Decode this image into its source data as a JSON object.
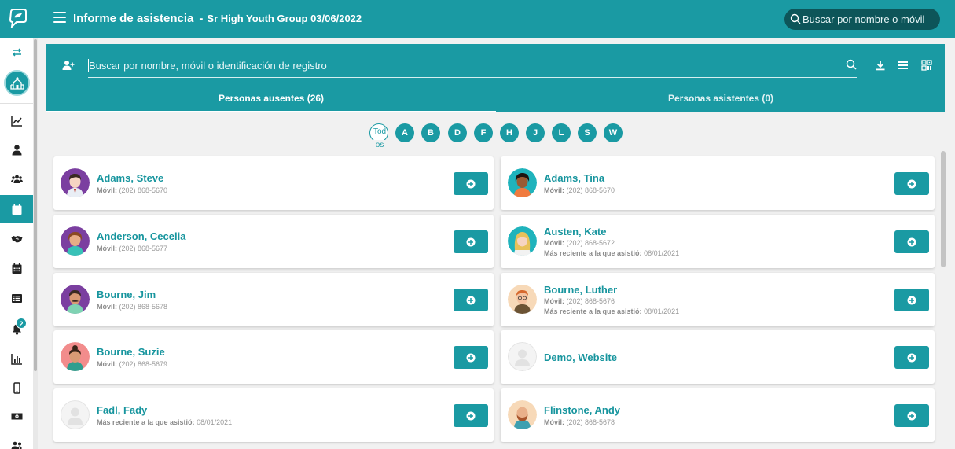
{
  "header": {
    "title": "Informe de asistencia",
    "separator": "-",
    "subtitle": "Sr High Youth Group 03/06/2022",
    "search_placeholder": "Buscar por nombre o móvil",
    "brand_color": "#1a9aa3"
  },
  "sidebar": {
    "items": [
      {
        "icon": "swap-icon"
      },
      {
        "icon": "church-icon"
      },
      {
        "icon": "trend-chart-icon"
      },
      {
        "icon": "person-icon"
      },
      {
        "icon": "group-icon"
      },
      {
        "icon": "calendar-icon",
        "active": true
      },
      {
        "icon": "handshake-icon"
      },
      {
        "icon": "calendar-grid-icon"
      },
      {
        "icon": "list-icon"
      },
      {
        "icon": "bell-icon"
      },
      {
        "icon": "bar-chart-icon"
      },
      {
        "icon": "mobile-icon"
      },
      {
        "icon": "money-icon"
      },
      {
        "icon": "people-gear-icon"
      }
    ],
    "notification_count": "2"
  },
  "search": {
    "placeholder": "Buscar por nombre, móvil o identificación de registro"
  },
  "tabs": [
    {
      "label": "Personas ausentes (26)",
      "active": true
    },
    {
      "label": "Personas asistentes (0)",
      "active": false
    }
  ],
  "letters": {
    "all_line1": "Tod",
    "all_line2": "os",
    "items": [
      "A",
      "B",
      "D",
      "F",
      "H",
      "J",
      "L",
      "S",
      "W"
    ]
  },
  "labels": {
    "mobile": "Móvil:",
    "last": "Más reciente a la que asistió:"
  },
  "people": [
    {
      "name": "Adams, Steve",
      "mobile": "(202) 868-5670",
      "last": ""
    },
    {
      "name": "Adams, Tina",
      "mobile": "(202) 868-5670",
      "last": ""
    },
    {
      "name": "Anderson, Cecelia",
      "mobile": "(202) 868-5677",
      "last": ""
    },
    {
      "name": "Austen, Kate",
      "mobile": "(202) 868-5672",
      "last": "08/01/2021"
    },
    {
      "name": "Bourne, Jim",
      "mobile": "(202) 868-5678",
      "last": ""
    },
    {
      "name": "Bourne, Luther",
      "mobile": "(202) 868-5676",
      "last": "08/01/2021"
    },
    {
      "name": "Bourne, Suzie",
      "mobile": "(202) 868-5679",
      "last": ""
    },
    {
      "name": "Demo, Website",
      "mobile": "",
      "last": ""
    },
    {
      "name": "Fadl, Fady",
      "mobile": "",
      "last": "08/01/2021"
    },
    {
      "name": "Flinstone, Andy",
      "mobile": "(202) 868-5678",
      "last": ""
    }
  ]
}
